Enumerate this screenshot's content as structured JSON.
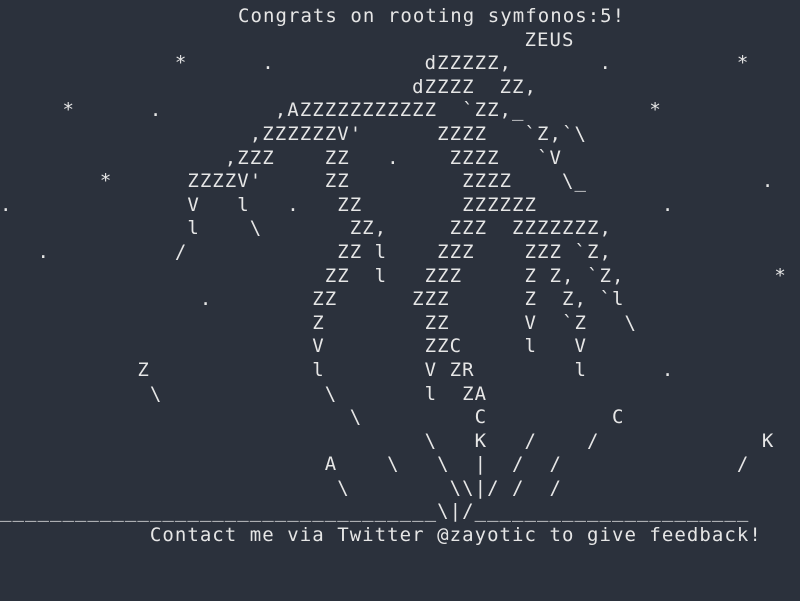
{
  "terminal": {
    "title": "Congrats on rooting symfonos:5!",
    "art_lines": [
      "                                          ZEUS",
      "              *      .            dZZZZZ,       .          *",
      "                                 dZZZZ  ZZ,",
      "     *      .         ,AZZZZZZZZZZZ  `ZZ,_          *",
      "                    ,ZZZZZZV'      ZZZZ   `Z,`\\",
      "                  ,ZZZ    ZZ   .    ZZZZ   `V",
      "        *      ZZZZV'     ZZ         ZZZZ    \\_              .",
      ".              V   l   .   ZZ        ZZZZZZ          .",
      "               l    \\       ZZ,     ZZZ  ZZZZZZZ,",
      "   .          /            ZZ l    ZZZ    ZZZ `Z,",
      "                          ZZ  l   ZZZ     Z Z, `Z,            *",
      "                .        ZZ      ZZZ      Z  Z, `l",
      "                         Z        ZZ      V  `Z   \\",
      "                         V        ZZC     l   V",
      "           Z             l        V ZR        l      .",
      "            \\             \\       l  ZA",
      "                            \\         C          C",
      "                                  \\   K   /    /             K",
      "                          A    \\   \\  |  /  /              /",
      "                           \\        \\\\|/ /  /"
    ],
    "divider_line": "___________________________________\\|/______________________",
    "footer": "            Contact me via Twitter @zayotic to give feedback!"
  }
}
